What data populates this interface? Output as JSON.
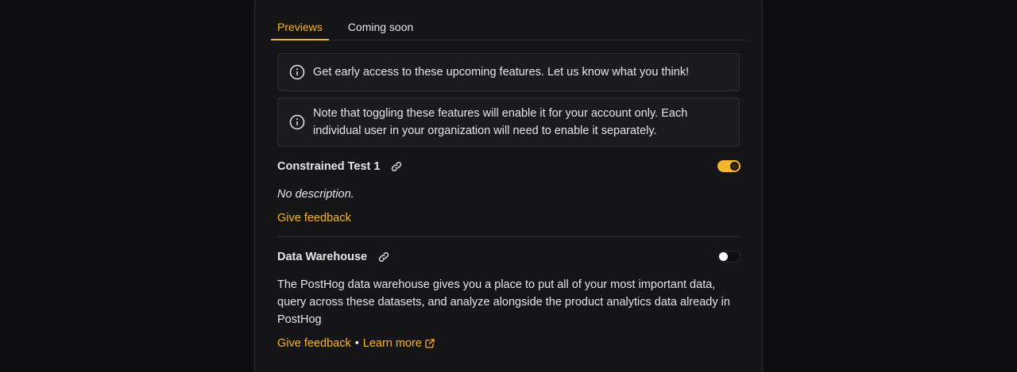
{
  "tabs": [
    {
      "label": "Previews",
      "active": true
    },
    {
      "label": "Coming soon",
      "active": false
    }
  ],
  "banners": [
    {
      "icon": "info-icon",
      "text": "Get early access to these upcoming features. Let us know what you think!"
    },
    {
      "icon": "info-icon",
      "text": "Note that toggling these features will enable it for your account only. Each individual user in your organization will need to enable it separately."
    }
  ],
  "features": [
    {
      "title": "Constrained Test 1",
      "enabled": true,
      "description": "No description.",
      "feedback_label": "Give feedback"
    },
    {
      "title": "Data Warehouse",
      "enabled": false,
      "description": "The PostHog data warehouse gives you a place to put all of your most important data, query across these datasets, and analyze alongside the product analytics data already in PostHog",
      "feedback_label": "Give feedback",
      "separator": "•",
      "learn_more_label": "Learn more"
    }
  ],
  "colors": {
    "accent": "#f7b52b",
    "background": "#0f0f11",
    "panel": "#151518"
  }
}
